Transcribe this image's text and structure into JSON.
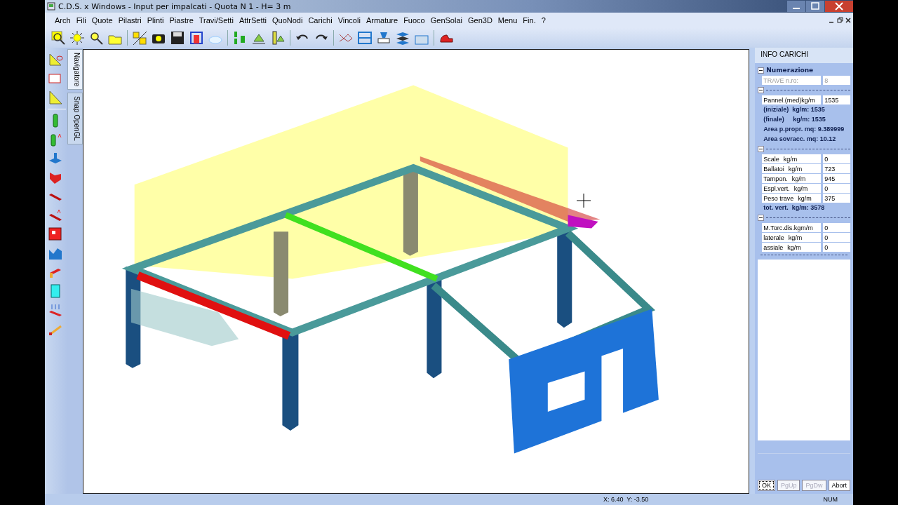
{
  "window": {
    "title": "C.D.S. x Windows - Input per impalcati - Quota N 1 - H= 3 m"
  },
  "menu": [
    {
      "label": "Arch"
    },
    {
      "label": "Fili"
    },
    {
      "label": "Quote"
    },
    {
      "label": "Pilastri"
    },
    {
      "label": "Plinti"
    },
    {
      "label": "Piastre"
    },
    {
      "label": "Travi/Setti"
    },
    {
      "label": "AttrSetti"
    },
    {
      "label": "QuoNodi"
    },
    {
      "label": "Carichi"
    },
    {
      "label": "Vincoli"
    },
    {
      "label": "Armature"
    },
    {
      "label": "Fuoco"
    },
    {
      "label": "GenSolai"
    },
    {
      "label": "Gen3D"
    },
    {
      "label": "Menu"
    },
    {
      "label": "Fin."
    },
    {
      "label": "?"
    }
  ],
  "side_tabs": [
    {
      "label": "Navigatore",
      "selected": true
    },
    {
      "label": "Snap OpenGL",
      "selected": false
    }
  ],
  "panel": {
    "title": "INFO CARICHI",
    "sections": [
      {
        "header": "Numerazione",
        "expanded": true,
        "rows": [
          {
            "kind": "field",
            "label": "TRAVE n.ro:",
            "value": "8",
            "disabled": true
          }
        ]
      },
      {
        "expanded": true,
        "rows": [
          {
            "kind": "field",
            "label": "Pannel.(med)kg/m",
            "value": "1535",
            "disabled": false
          },
          {
            "kind": "text",
            "text": "(iniziale)  kg/m: 1535"
          },
          {
            "kind": "text",
            "text": "(finale)     kg/m: 1535"
          },
          {
            "kind": "text",
            "text": "Area p.propr. mq: 9.389999"
          },
          {
            "kind": "text",
            "text": "Area sovracc. mq: 10.12"
          }
        ]
      },
      {
        "expanded": true,
        "rows": [
          {
            "kind": "field",
            "label": "Scale",
            "unit": "kg/m",
            "value": "0",
            "disabled": false
          },
          {
            "kind": "field",
            "label": "Ballatoi",
            "unit": "kg/m",
            "value": "723",
            "disabled": false
          },
          {
            "kind": "field",
            "label": "Tampon.",
            "unit": "kg/m",
            "value": "945",
            "disabled": false
          },
          {
            "kind": "field",
            "label": "Espl.vert.",
            "unit": "kg/m",
            "value": "0",
            "disabled": false
          },
          {
            "kind": "field",
            "label": "Peso trave",
            "unit": "kg/m",
            "value": "375",
            "disabled": false
          },
          {
            "kind": "text",
            "text": "tot. vert.  kg/m: 3578"
          }
        ]
      },
      {
        "expanded": true,
        "rows": [
          {
            "kind": "field",
            "label": "M.Torc.dis.kgm/m",
            "value": "0",
            "disabled": false
          },
          {
            "kind": "field",
            "label": "laterale",
            "unit": "kg/m",
            "value": "0",
            "disabled": false
          },
          {
            "kind": "field",
            "label": "assiale",
            "unit": "kg/m",
            "value": "0",
            "disabled": false
          }
        ]
      }
    ]
  },
  "buttons": [
    {
      "label": "OK",
      "disabled": false,
      "selected": true
    },
    {
      "label": "PgUp",
      "disabled": true,
      "selected": false
    },
    {
      "label": "PgDw",
      "disabled": true,
      "selected": false
    },
    {
      "label": "Abort",
      "disabled": false,
      "selected": false
    }
  ],
  "status_bar": {
    "coordinates": "X: 6.40  Y: -3.50",
    "num": "NUM"
  }
}
